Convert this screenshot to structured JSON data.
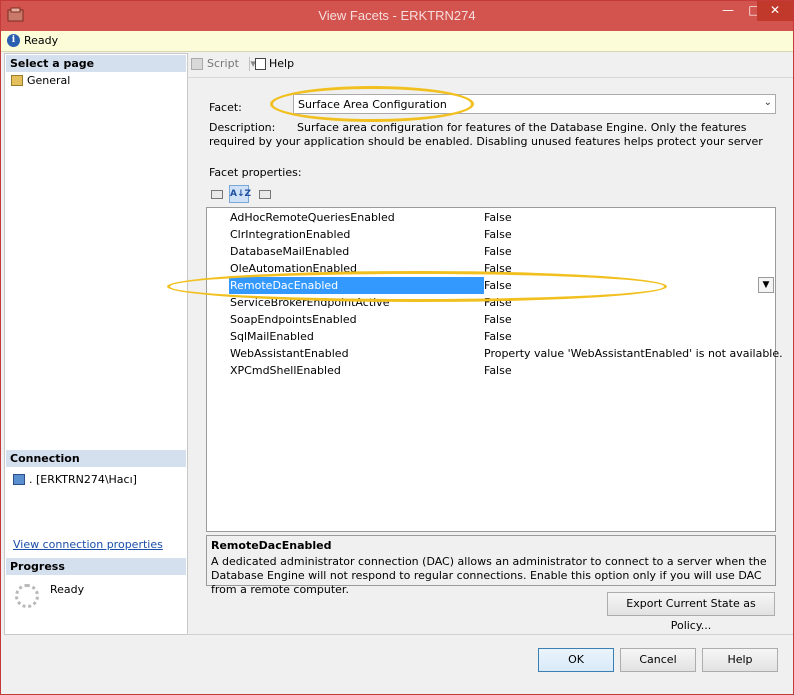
{
  "window": {
    "title": "View Facets - ERKTRN274"
  },
  "status": {
    "text": "Ready"
  },
  "left_pane": {
    "select_page_header": "Select a page",
    "pages": [
      {
        "label": "General"
      }
    ],
    "connection_header": "Connection",
    "connection_value": ". [ERKTRN274\\Hacı]",
    "connection_link": "View connection properties",
    "progress_header": "Progress",
    "progress_status": "Ready"
  },
  "toolbar": {
    "script_label": "Script",
    "help_label": "Help"
  },
  "facet": {
    "label": "Facet:",
    "value": "Surface Area Configuration",
    "description_label": "Description:",
    "description": "Surface area configuration for features of the Database Engine. Only the features required by your application should be enabled. Disabling unused features helps protect your server by reducing the"
  },
  "facet_properties": {
    "label": "Facet properties:",
    "sort_button": "A↓Z",
    "rows": [
      {
        "name": "AdHocRemoteQueriesEnabled",
        "value": "False"
      },
      {
        "name": "ClrIntegrationEnabled",
        "value": "False"
      },
      {
        "name": "DatabaseMailEnabled",
        "value": "False"
      },
      {
        "name": "OleAutomationEnabled",
        "value": "False"
      },
      {
        "name": "RemoteDacEnabled",
        "value": "False"
      },
      {
        "name": "ServiceBrokerEndpointActive",
        "value": "False"
      },
      {
        "name": "SoapEndpointsEnabled",
        "value": "False"
      },
      {
        "name": "SqlMailEnabled",
        "value": "False"
      },
      {
        "name": "WebAssistantEnabled",
        "value": "Property value 'WebAssistantEnabled' is not available."
      },
      {
        "name": "XPCmdShellEnabled",
        "value": "False"
      }
    ],
    "selected_index": 4
  },
  "property_help": {
    "title": "RemoteDacEnabled",
    "description": "A dedicated administrator connection (DAC) allows an administrator to connect to a server when the Database Engine will not respond to regular connections. Enable this option only if you will use DAC from a remote computer."
  },
  "buttons": {
    "export": "Export Current State as Policy...",
    "ok": "OK",
    "cancel": "Cancel",
    "help": "Help"
  },
  "colors": {
    "title_bar": "#d3544f",
    "selection": "#3399ff",
    "highlight_annotation": "#f2c01e",
    "section_header": "#d5e0ef"
  }
}
